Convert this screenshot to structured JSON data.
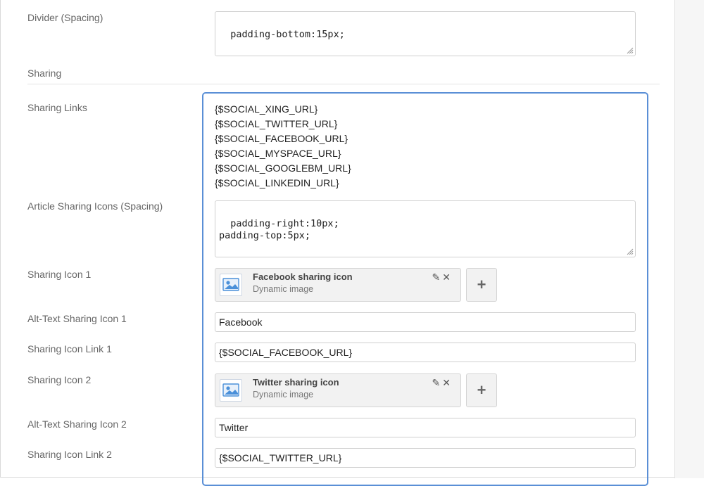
{
  "fields": {
    "divider_spacing": {
      "label": "Divider (Spacing)",
      "value": "padding-bottom:15px;"
    },
    "sharing_section": {
      "title": "Sharing"
    },
    "sharing_links": {
      "label": "Sharing Links",
      "tokens": [
        "{$SOCIAL_XING_URL}",
        "{$SOCIAL_TWITTER_URL}",
        "{$SOCIAL_FACEBOOK_URL}",
        "{$SOCIAL_MYSPACE_URL}",
        "{$SOCIAL_GOOGLEBM_URL}",
        "{$SOCIAL_LINKEDIN_URL}"
      ]
    },
    "article_icons_spacing": {
      "label": "Article Sharing Icons (Spacing)",
      "value": "padding-right:10px;\npadding-top:5px;"
    },
    "icon1": {
      "label": "Sharing Icon 1",
      "title": "Facebook sharing icon",
      "subtitle": "Dynamic image"
    },
    "alt1": {
      "label": "Alt-Text Sharing Icon 1",
      "value": "Facebook"
    },
    "link1": {
      "label": "Sharing Icon Link 1",
      "value": "{$SOCIAL_FACEBOOK_URL}"
    },
    "icon2": {
      "label": "Sharing Icon 2",
      "title": "Twitter sharing icon",
      "subtitle": "Dynamic image"
    },
    "alt2": {
      "label": "Alt-Text Sharing Icon 2",
      "value": "Twitter"
    },
    "link2": {
      "label": "Sharing Icon Link 2",
      "value": "{$SOCIAL_TWITTER_URL}"
    }
  },
  "icons": {
    "edit": "pencil-icon",
    "remove": "close-icon",
    "add": "plus-icon",
    "image": "image-icon",
    "resize": "resize-grip-icon",
    "edit_glyph": "✎",
    "remove_glyph": "✕",
    "add_glyph": "+"
  },
  "colors": {
    "focus_border": "#5a8fd6",
    "label": "#666666",
    "card_bg": "#f2f2f2"
  }
}
